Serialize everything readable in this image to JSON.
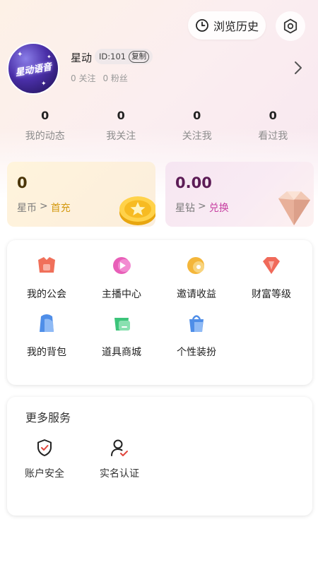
{
  "header": {
    "history_label": "浏览历史",
    "history_icon": "clock-icon",
    "settings_icon": "hexagon-gear-icon"
  },
  "profile": {
    "avatar_text": "星动语音",
    "name": "星动",
    "id_text": "ID:101",
    "copy_label": "复制",
    "following": "0 关注",
    "fans": "0 粉丝"
  },
  "stats": [
    {
      "value": "0",
      "label": "我的动态"
    },
    {
      "value": "0",
      "label": "我关注"
    },
    {
      "value": "0",
      "label": "关注我"
    },
    {
      "value": "0",
      "label": "看过我"
    }
  ],
  "wallet": {
    "coins": {
      "value": "0",
      "name": "星币",
      "sep": ">",
      "action": "首充",
      "accent": "#d49a12"
    },
    "diamonds": {
      "value": "0.00",
      "name": "星钻",
      "sep": ">",
      "action": "兑换",
      "accent": "#c63fa1"
    }
  },
  "features": [
    {
      "label": "我的公会",
      "icon": "guild-icon",
      "color": "#f0705a"
    },
    {
      "label": "主播中心",
      "icon": "anchor-center-icon",
      "color": "#e85fb8"
    },
    {
      "label": "邀请收益",
      "icon": "invite-earnings-icon",
      "color": "#f4b63a"
    },
    {
      "label": "财富等级",
      "icon": "wealth-level-icon",
      "color": "#f06a5a"
    },
    {
      "label": "我的背包",
      "icon": "backpack-icon",
      "color": "#4f8ee8"
    },
    {
      "label": "道具商城",
      "icon": "props-mall-icon",
      "color": "#3cc47a"
    },
    {
      "label": "个性装扮",
      "icon": "dress-up-icon",
      "color": "#4f8ee8"
    }
  ],
  "more_services": {
    "title": "更多服务",
    "items": [
      {
        "label": "账户安全",
        "icon": "shield-icon"
      },
      {
        "label": "实名认证",
        "icon": "user-verify-icon"
      }
    ]
  }
}
